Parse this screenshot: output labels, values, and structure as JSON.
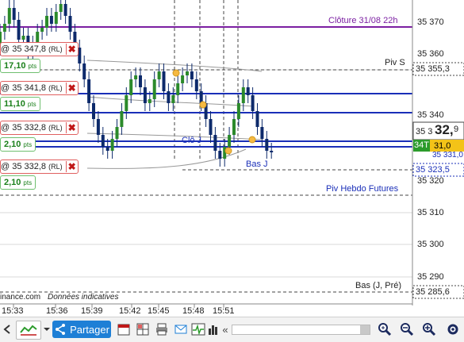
{
  "chart": {
    "y_axis_ticks": [
      "35 370",
      "35 360",
      "35 340",
      "35 330",
      "35 320",
      "35 310",
      "35 300",
      "35 290"
    ],
    "x_axis_ticks": [
      "15:33",
      "15:36",
      "15:39",
      "15:42",
      "15:45",
      "15:48",
      "15:51"
    ],
    "price_tags": {
      "pivot_s": "35 355,3",
      "current_left": "35 3",
      "current_big": "32,",
      "current_small": "9",
      "bid_badge": "34T",
      "bid_value": "31,0",
      "hidden_under": "35 331,0",
      "bas_j": "35 323,5",
      "bas_j_pre": "35 285,6"
    },
    "level_labels": {
      "cloture": "Clôture 31/08 22h",
      "piv_s": "Piv S",
      "piv_hebdo": "Piv Hebdo Futures",
      "bas_j_pre": "Bas (J, Pré)",
      "clo_j": "Clô J",
      "bas_j": "Bas J"
    },
    "source_prefix": "inance.com",
    "source_note": "Données indicatives",
    "colors": {
      "cloture_line": "#7b1fa2",
      "order_line": "#1a2fb8",
      "candle": "#0d2a6b",
      "marker": "#f5b942",
      "bid_badge_bg": "#2b9b2b",
      "bid_value_bg": "#f3c318"
    }
  },
  "orders": [
    {
      "price": "@ 35 347,8",
      "type": "(RL)",
      "pts": "17,10",
      "unit": "pts"
    },
    {
      "price": "@ 35 341,8",
      "type": "(RL)",
      "pts": "11,10",
      "unit": "pts"
    },
    {
      "price": "@ 35 332,8",
      "type": "(RL)",
      "pts": "2,10",
      "unit": "pts"
    },
    {
      "price": "@ 35 332,8",
      "type": "(RL)",
      "pts": "2,10",
      "unit": "pts"
    }
  ],
  "toolbar": {
    "share_label": "Partager",
    "icons": [
      "arrow-left-icon",
      "indicator-chart-icon",
      "dropdown-icon",
      "share-icon",
      "calendar-icon",
      "grid-icon",
      "print-icon",
      "email-icon",
      "heartbeat-icon",
      "save-chart-icon",
      "screenshot-icon",
      "bar-chart-icon",
      "scroll-left-icon",
      "scrollbar",
      "zoom-fit-icon",
      "zoom-out-icon",
      "zoom-in-icon",
      "settings-icon"
    ]
  }
}
